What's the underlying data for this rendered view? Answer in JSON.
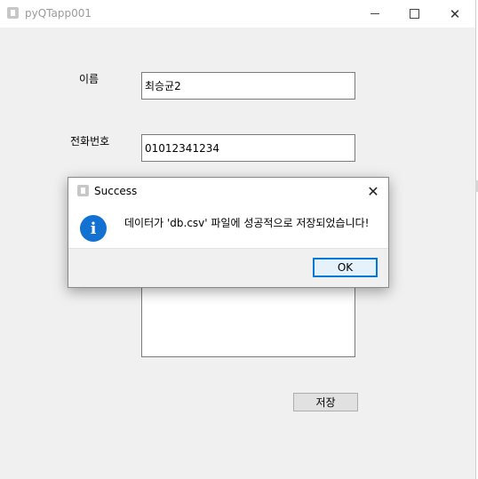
{
  "window": {
    "title": "pyQTapp001",
    "min_glyph": "",
    "max_glyph": "",
    "close_glyph": "✕"
  },
  "form": {
    "name_label": "이름",
    "name_value": "최승균2",
    "phone_label": "전화번호",
    "phone_value": "01012341234",
    "memo_value": "",
    "save_label": "저장"
  },
  "dialog": {
    "title": "Success",
    "close_glyph": "✕",
    "icon_glyph": "i",
    "message": "데이터가 'db.csv' 파일에 성공적으로 저장되었습니다!",
    "ok_label": "OK"
  },
  "colors": {
    "accent": "#0078d7",
    "info_icon": "#1372d1",
    "window_bg": "#f0f0f0"
  },
  "icons": [
    "app-icon",
    "minimize-icon",
    "maximize-icon",
    "close-icon",
    "info-icon"
  ]
}
